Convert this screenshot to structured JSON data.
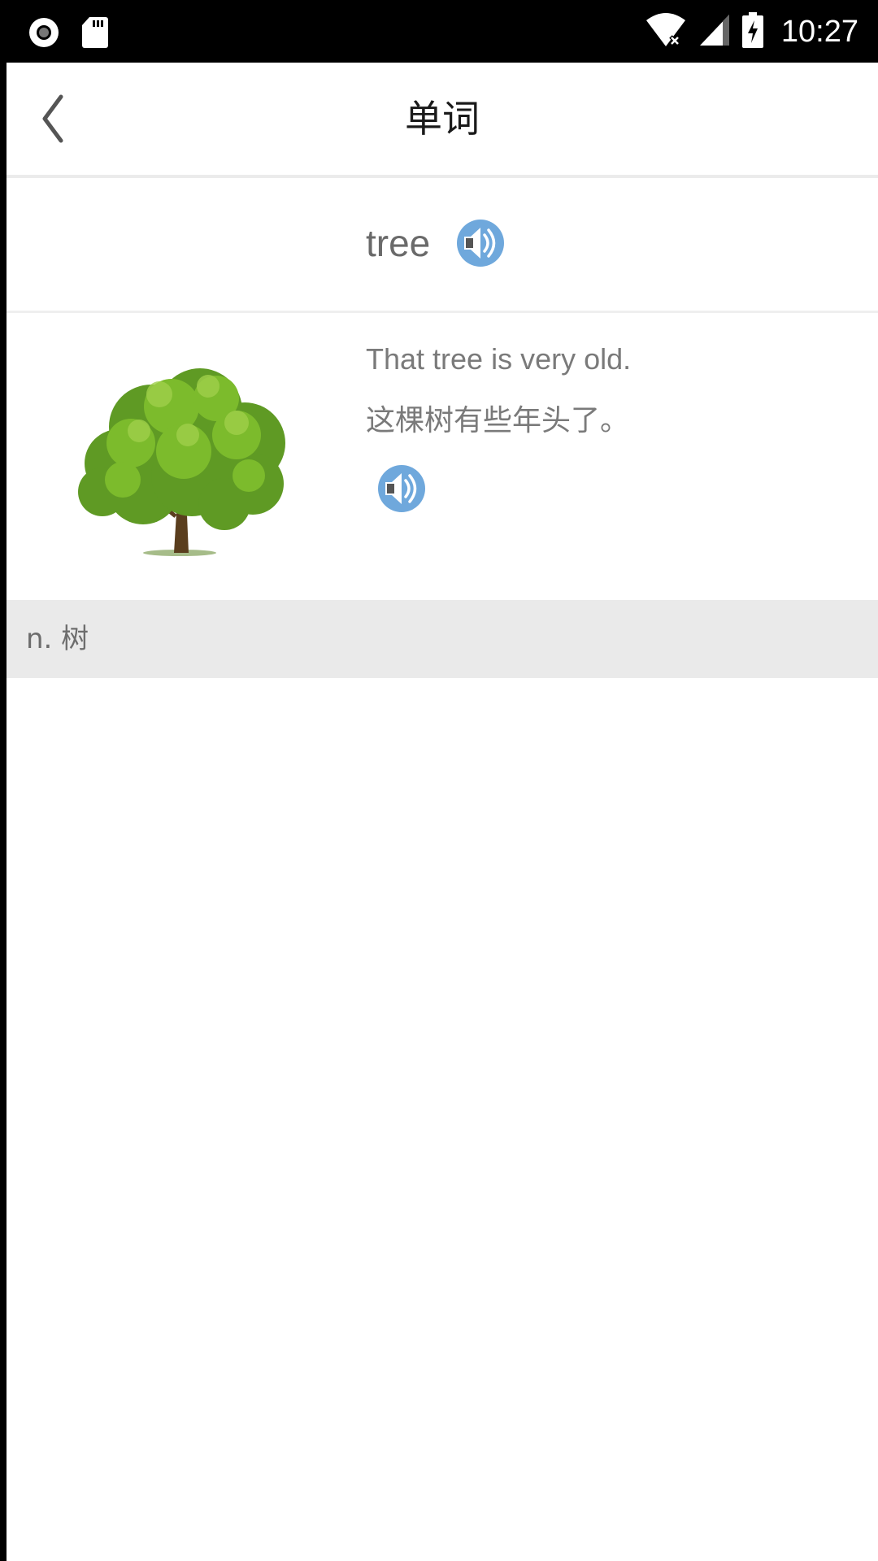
{
  "status_bar": {
    "time": "10:27",
    "left_icons": [
      "circle-record-icon",
      "sd-card-icon"
    ],
    "right_icons": [
      "wifi-icon",
      "cell-signal-icon",
      "battery-charging-icon"
    ]
  },
  "header": {
    "title": "单词",
    "back_icon": "chevron-left-icon"
  },
  "word": {
    "text": "tree",
    "audio_icon": "speaker-icon"
  },
  "example": {
    "image": "tree-image",
    "sentence_en": "That tree is very old.",
    "sentence_zh": "这棵树有些年头了。",
    "audio_icon": "speaker-icon"
  },
  "definition": {
    "text": "n. 树"
  },
  "colors": {
    "speaker_blue": "#6fa8dc",
    "text_gray": "#7a7a7a",
    "definition_bg": "#eaeaea"
  }
}
